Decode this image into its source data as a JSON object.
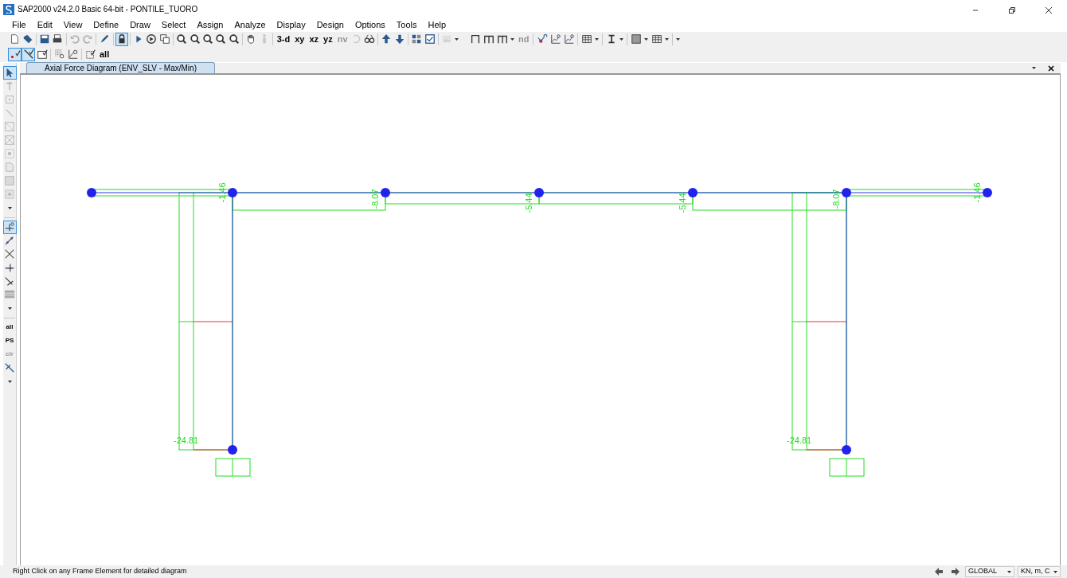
{
  "window": {
    "title": "SAP2000 v24.2.0 Basic 64-bit - PONTILE_TUORO"
  },
  "menu": [
    "File",
    "Edit",
    "View",
    "Define",
    "Draw",
    "Select",
    "Assign",
    "Analyze",
    "Display",
    "Design",
    "Options",
    "Tools",
    "Help"
  ],
  "toolbar_1": [
    {
      "kind": "icon",
      "disabled": false,
      "selected": false
    },
    {
      "kind": "icon",
      "disabled": false,
      "selected": false
    },
    {
      "kind": "sep"
    },
    {
      "kind": "icon",
      "disabled": false,
      "selected": false
    },
    {
      "kind": "icon",
      "disabled": false,
      "selected": false
    },
    {
      "kind": "sep"
    },
    {
      "kind": "icon",
      "disabled": true,
      "selected": false
    },
    {
      "kind": "icon",
      "disabled": true,
      "selected": false
    },
    {
      "kind": "sep"
    },
    {
      "kind": "icon",
      "disabled": false,
      "selected": false
    },
    {
      "kind": "sep"
    },
    {
      "kind": "icon",
      "disabled": false,
      "selected": true
    },
    {
      "kind": "sep"
    },
    {
      "kind": "icon",
      "disabled": false,
      "selected": false
    },
    {
      "kind": "icon",
      "disabled": false,
      "selected": false
    },
    {
      "kind": "icon",
      "disabled": false,
      "selected": false
    },
    {
      "kind": "sep"
    },
    {
      "kind": "icon",
      "disabled": false,
      "selected": false
    },
    {
      "kind": "icon",
      "disabled": false,
      "selected": false
    },
    {
      "kind": "icon",
      "disabled": false,
      "selected": false
    },
    {
      "kind": "icon",
      "disabled": false,
      "selected": false
    },
    {
      "kind": "icon",
      "disabled": false,
      "selected": false
    },
    {
      "kind": "sep"
    },
    {
      "kind": "icon",
      "disabled": false,
      "selected": false
    },
    {
      "kind": "icon",
      "disabled": true,
      "selected": false
    },
    {
      "kind": "sep"
    },
    {
      "kind": "text",
      "label": "3-d",
      "disabled": false,
      "selected": false
    },
    {
      "kind": "text",
      "label": "xy",
      "disabled": false,
      "selected": false
    },
    {
      "kind": "text",
      "label": "xz",
      "disabled": false,
      "selected": false
    },
    {
      "kind": "text",
      "label": "yz",
      "disabled": false,
      "selected": false
    },
    {
      "kind": "text",
      "label": "nv",
      "disabled": true,
      "selected": false
    },
    {
      "kind": "icon",
      "disabled": true,
      "selected": false
    },
    {
      "kind": "icon",
      "disabled": false,
      "selected": false
    },
    {
      "kind": "sep"
    },
    {
      "kind": "icon",
      "disabled": false,
      "selected": false
    },
    {
      "kind": "icon",
      "disabled": false,
      "selected": false
    },
    {
      "kind": "sep"
    },
    {
      "kind": "icon",
      "disabled": false,
      "selected": false
    },
    {
      "kind": "icon",
      "disabled": false,
      "selected": false
    },
    {
      "kind": "sep"
    },
    {
      "kind": "icon",
      "disabled": true,
      "selected": false
    },
    {
      "kind": "caret"
    }
  ],
  "toolbar_2": [
    {
      "kind": "icon",
      "disabled": false,
      "selected": false
    },
    {
      "kind": "icon",
      "disabled": false,
      "selected": false
    },
    {
      "kind": "icon",
      "disabled": false,
      "selected": false
    },
    {
      "kind": "caret"
    },
    {
      "kind": "text",
      "label": "nd",
      "disabled": true,
      "selected": false
    },
    {
      "kind": "sep"
    },
    {
      "kind": "icon",
      "disabled": false,
      "selected": false
    },
    {
      "kind": "icon",
      "disabled": false,
      "selected": false
    },
    {
      "kind": "icon",
      "disabled": false,
      "selected": false
    },
    {
      "kind": "sep"
    },
    {
      "kind": "icon",
      "disabled": false,
      "selected": false
    },
    {
      "kind": "caret"
    },
    {
      "kind": "sep"
    },
    {
      "kind": "icon",
      "disabled": false,
      "selected": false
    },
    {
      "kind": "caret"
    },
    {
      "kind": "sep"
    },
    {
      "kind": "icon",
      "disabled": false,
      "selected": false
    },
    {
      "kind": "caret"
    },
    {
      "kind": "icon",
      "disabled": false,
      "selected": false
    },
    {
      "kind": "caret"
    },
    {
      "kind": "sep"
    },
    {
      "kind": "caret"
    }
  ],
  "toolbar_3": [
    {
      "kind": "icon",
      "disabled": false,
      "selected": true
    },
    {
      "kind": "icon",
      "disabled": false,
      "selected": true
    },
    {
      "kind": "icon",
      "disabled": false,
      "selected": false
    },
    {
      "kind": "sep"
    },
    {
      "kind": "icon",
      "disabled": false,
      "selected": false
    },
    {
      "kind": "icon",
      "disabled": false,
      "selected": false
    },
    {
      "kind": "sep"
    },
    {
      "kind": "icon",
      "disabled": false,
      "selected": false
    },
    {
      "kind": "text",
      "label": "all",
      "disabled": false,
      "selected": false
    }
  ],
  "side_toolbar": [
    {
      "kind": "icon",
      "disabled": false,
      "selected": true
    },
    {
      "kind": "icon",
      "disabled": true,
      "selected": false
    },
    {
      "kind": "icon",
      "disabled": true,
      "selected": false
    },
    {
      "kind": "icon",
      "disabled": true,
      "selected": false
    },
    {
      "kind": "icon",
      "disabled": true,
      "selected": false
    },
    {
      "kind": "icon",
      "disabled": true,
      "selected": false
    },
    {
      "kind": "icon",
      "disabled": true,
      "selected": false
    },
    {
      "kind": "icon",
      "disabled": true,
      "selected": false
    },
    {
      "kind": "icon",
      "disabled": true,
      "selected": false
    },
    {
      "kind": "icon",
      "disabled": true,
      "selected": false
    },
    {
      "kind": "caret"
    },
    {
      "kind": "sep"
    },
    {
      "kind": "icon",
      "disabled": false,
      "selected": true
    },
    {
      "kind": "icon",
      "disabled": false,
      "selected": false
    },
    {
      "kind": "icon",
      "disabled": false,
      "selected": false
    },
    {
      "kind": "icon",
      "disabled": false,
      "selected": false
    },
    {
      "kind": "icon",
      "disabled": false,
      "selected": false
    },
    {
      "kind": "icon",
      "disabled": false,
      "selected": false
    },
    {
      "kind": "caret"
    },
    {
      "kind": "sep"
    },
    {
      "kind": "text",
      "label": "all",
      "disabled": false,
      "selected": false
    },
    {
      "kind": "text",
      "label": "PS",
      "disabled": false,
      "selected": false
    },
    {
      "kind": "text",
      "label": "clr",
      "disabled": true,
      "selected": false
    },
    {
      "kind": "icon",
      "disabled": false,
      "selected": false
    },
    {
      "kind": "caret"
    }
  ],
  "tabs": [
    {
      "label": "Axial Force Diagram (ENV_SLV - Max/Min)",
      "selected": true
    }
  ],
  "diagram": {
    "values": [
      {
        "text": "-1.46"
      },
      {
        "text": "-8.07"
      },
      {
        "text": "-5.44"
      },
      {
        "text": "-5.44"
      },
      {
        "text": "-8.07"
      },
      {
        "text": "-1.46"
      },
      {
        "text": "-24.81"
      },
      {
        "text": "-24.81"
      }
    ]
  },
  "status_bar": {
    "message": "Right Click on any Frame Element for detailed diagram",
    "coordinate_system": "GLOBAL",
    "units": "KN, m, C"
  }
}
